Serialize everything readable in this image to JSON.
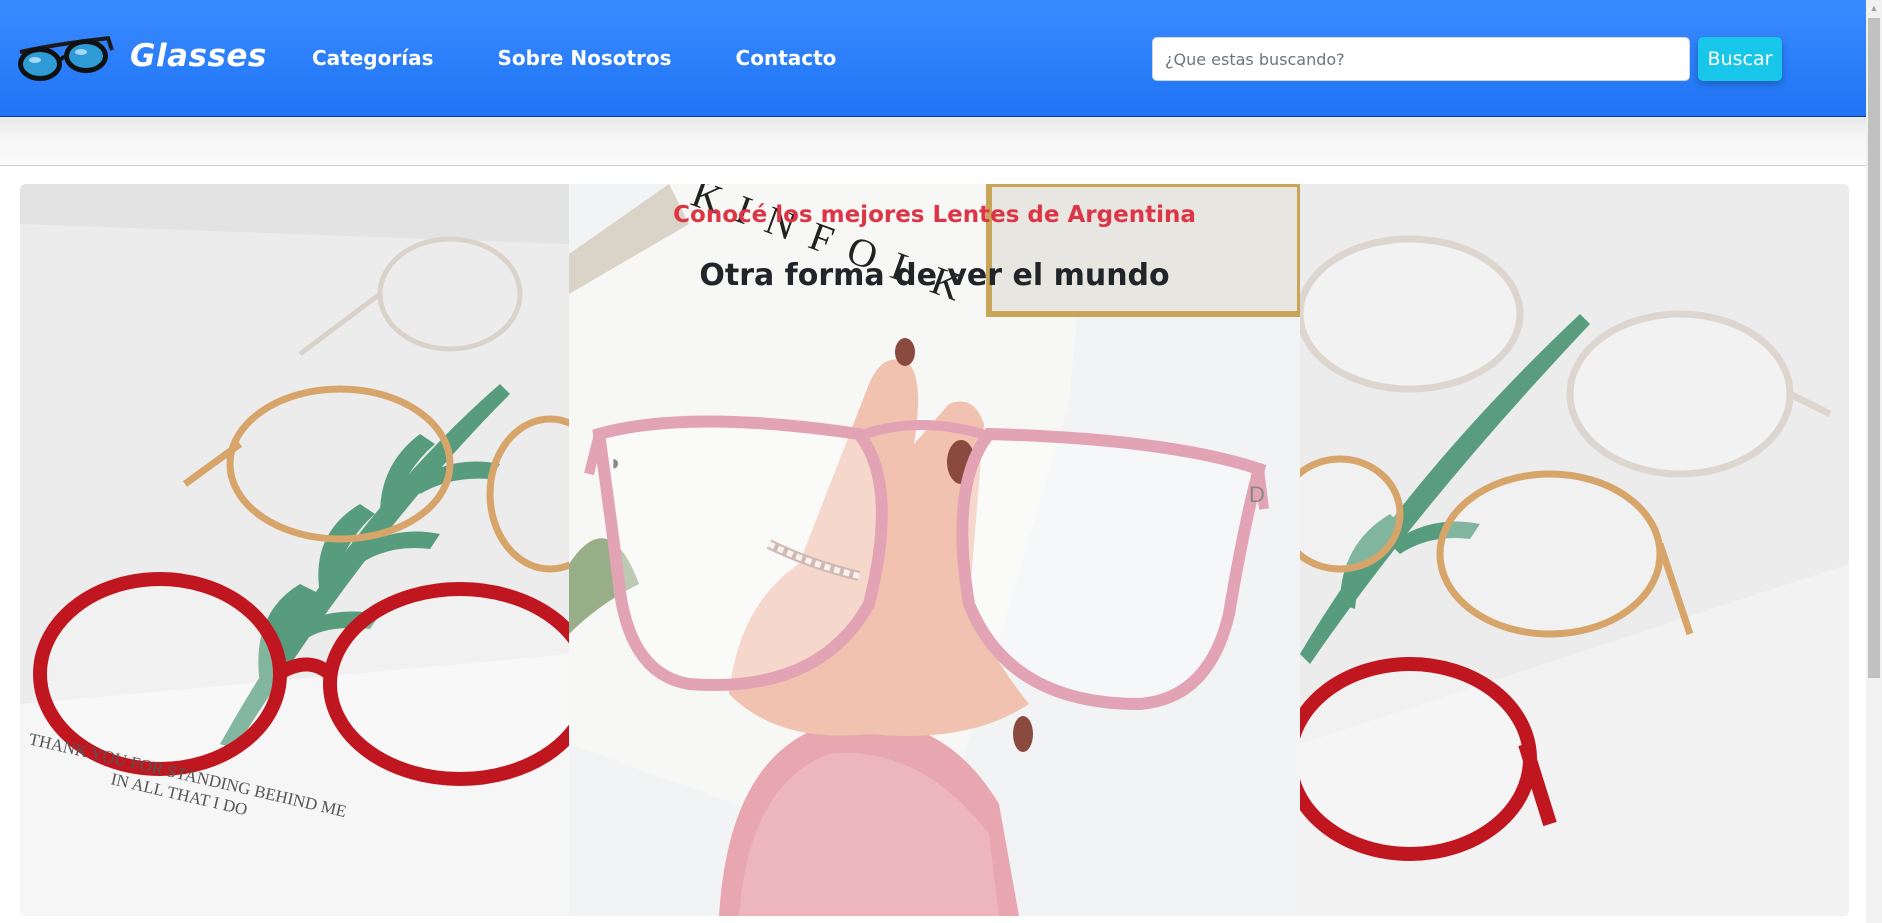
{
  "brand": {
    "name": "Glasses",
    "logo": "sunglasses-logo-icon"
  },
  "nav": {
    "links": [
      {
        "label": "Categorías"
      },
      {
        "label": "Sobre Nosotros"
      },
      {
        "label": "Contacto"
      }
    ]
  },
  "search": {
    "placeholder": "¿Que estas buscando?",
    "value": "",
    "button_label": "Buscar"
  },
  "carousel": {
    "caption_subtitle": "Conocé los mejores Lentes de Argentina",
    "caption_title": "Otra forma de ver el mundo",
    "left_image_text": [
      "THANK YOU FOR STANDING BEHIND ME",
      "IN ALL THAT I DO"
    ],
    "center_image_text": "KINFOLK"
  },
  "colors": {
    "navbar": "#2a7ef7",
    "search_button": "#17c6e8",
    "caption_subtitle": "#dc3545",
    "caption_title": "#212529"
  }
}
